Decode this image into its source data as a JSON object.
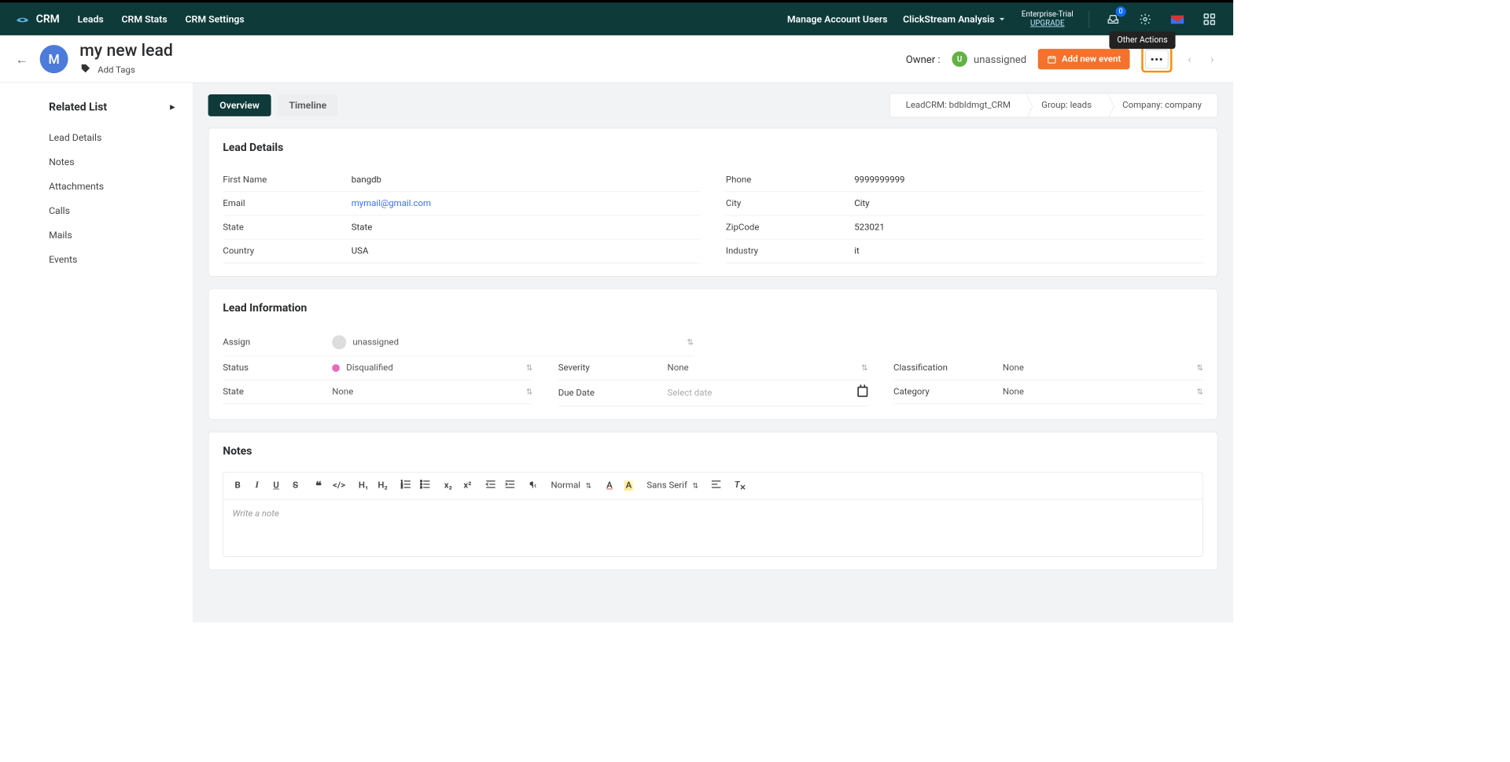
{
  "nav": {
    "brand": "CRM",
    "links": [
      "Leads",
      "CRM Stats",
      "CRM Settings"
    ],
    "manage_users": "Manage Account Users",
    "clickstream": "ClickStream Analysis",
    "enterprise_line1": "Enterprise-Trial",
    "enterprise_line2": "UPGRADE",
    "mail_badge": "0"
  },
  "header": {
    "avatar_letter": "M",
    "title": "my new lead",
    "add_tags": "Add Tags",
    "owner_label": "Owner :",
    "owner_avatar": "U",
    "owner_name": "unassigned",
    "add_event_btn": "Add new event",
    "tooltip": "Other Actions"
  },
  "sidebar": {
    "title": "Related List",
    "items": [
      "Lead Details",
      "Notes",
      "Attachments",
      "Calls",
      "Mails",
      "Events"
    ]
  },
  "tabs": {
    "overview": "Overview",
    "timeline": "Timeline"
  },
  "breadcrumb": {
    "a": "LeadCRM: bdbldmgt_CRM",
    "b": "Group: leads",
    "c": "Company: company"
  },
  "lead_details": {
    "title": "Lead Details",
    "left": [
      {
        "label": "First Name",
        "value": "bangdb"
      },
      {
        "label": "Email",
        "value": "mymail@gmail.com",
        "link": true
      },
      {
        "label": "State",
        "value": "State"
      },
      {
        "label": "Country",
        "value": "USA"
      }
    ],
    "right": [
      {
        "label": "Phone",
        "value": "9999999999"
      },
      {
        "label": "City",
        "value": "City"
      },
      {
        "label": "ZipCode",
        "value": "523021"
      },
      {
        "label": "Industry",
        "value": "it"
      }
    ]
  },
  "lead_info": {
    "title": "Lead Information",
    "assign_label": "Assign",
    "assign_value": "unassigned",
    "row1": {
      "status_label": "Status",
      "status_value": "Disqualified",
      "status_color": "#e46bbf",
      "severity_label": "Severity",
      "severity_value": "None",
      "classification_label": "Classification",
      "classification_value": "None"
    },
    "row2": {
      "state_label": "State",
      "state_value": "None",
      "due_label": "Due Date",
      "due_placeholder": "Select date",
      "category_label": "Category",
      "category_value": "None"
    }
  },
  "notes": {
    "title": "Notes",
    "placeholder": "Write a note",
    "size_label": "Normal",
    "font_label": "Sans Serif"
  }
}
